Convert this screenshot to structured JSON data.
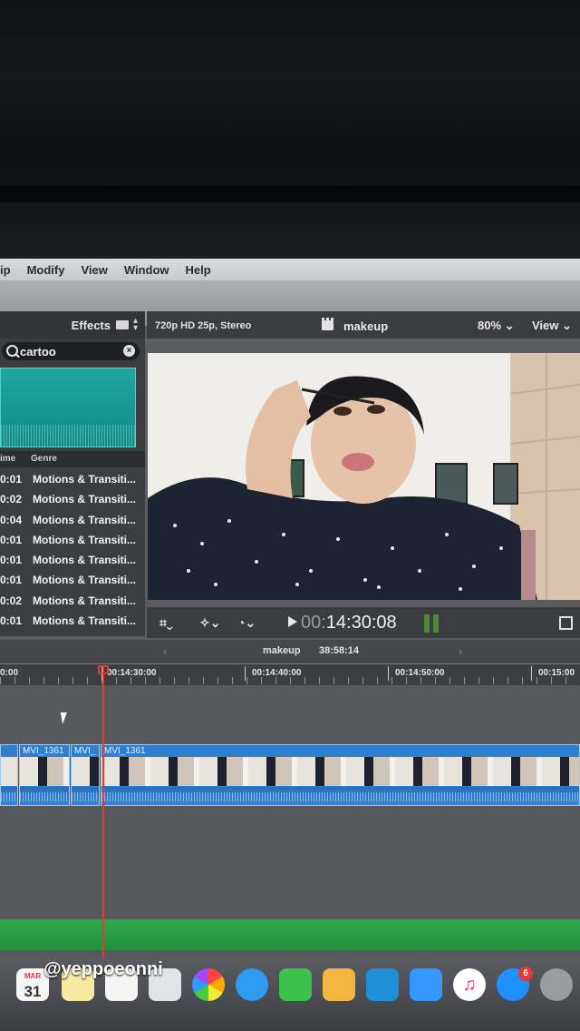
{
  "menu": [
    "ip",
    "Modify",
    "View",
    "Window",
    "Help"
  ],
  "browser": {
    "panel_title": "Effects",
    "search_value": "cartoo",
    "columns": [
      "ime",
      "Genre"
    ],
    "rows": [
      {
        "time": "0:01",
        "genre": "Motions & Transiti..."
      },
      {
        "time": "0:02",
        "genre": "Motions & Transiti..."
      },
      {
        "time": "0:04",
        "genre": "Motions & Transiti..."
      },
      {
        "time": "0:01",
        "genre": "Motions & Transiti..."
      },
      {
        "time": "0:01",
        "genre": "Motions & Transiti..."
      },
      {
        "time": "0:01",
        "genre": "Motions & Transiti..."
      },
      {
        "time": "0:02",
        "genre": "Motions & Transiti..."
      },
      {
        "time": "0:01",
        "genre": "Motions & Transiti..."
      }
    ]
  },
  "viewer": {
    "format": "720p HD 25p, Stereo",
    "project": "makeup",
    "zoom": "80% ⌄",
    "view": "View ⌄",
    "timecode_prefix": "00:",
    "timecode": "14:30:08"
  },
  "timeline": {
    "project": "makeup",
    "duration": "38:58:14",
    "ruler": [
      "0:00",
      "00:14:30:00",
      "00:14:40:00",
      "00:14:50:00",
      "00:15:00"
    ],
    "clips": [
      "",
      "MVI_1361",
      "MVI_",
      "MVI_1361"
    ]
  },
  "watermark": "@yeppoeonni",
  "dock": {
    "calendar_month": "MAR",
    "calendar_day": "31",
    "badge": "6"
  }
}
